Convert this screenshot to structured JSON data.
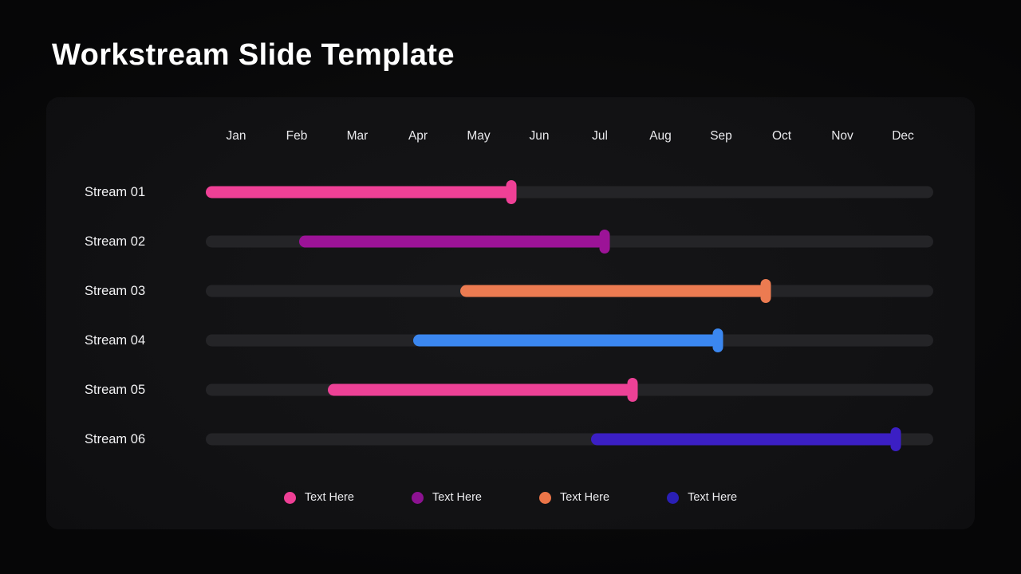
{
  "slide": {
    "title": "Workstream Slide Template",
    "background_color": "#060607",
    "card_color": "#121214",
    "track_color": "#242427"
  },
  "axis": {
    "months": [
      "Jan",
      "Feb",
      "Mar",
      "Apr",
      "May",
      "Jun",
      "Jul",
      "Aug",
      "Sep",
      "Oct",
      "Nov",
      "Dec"
    ]
  },
  "chart_data": {
    "type": "bar",
    "title": "Workstream Slide Template",
    "xlabel": "",
    "ylabel": "",
    "categories": [
      "Jan",
      "Feb",
      "Mar",
      "Apr",
      "May",
      "Jun",
      "Jul",
      "Aug",
      "Sep",
      "Oct",
      "Nov",
      "Dec"
    ],
    "grid": false,
    "legend_position": "bottom",
    "rows": [
      {
        "label": "Stream 01",
        "color": "#ef4096",
        "start_pct": 0.0,
        "end_pct": 42.0,
        "start_month": "Jan",
        "end_month": "Jun"
      },
      {
        "label": "Stream 02",
        "color": "#9c1397",
        "start_pct": 12.8,
        "end_pct": 54.8,
        "start_month": "Feb",
        "end_month": "Jul"
      },
      {
        "label": "Stream 03",
        "color": "#ec7b51",
        "start_pct": 35.0,
        "end_pct": 77.0,
        "start_month": "Apr",
        "end_month": "Sep"
      },
      {
        "label": "Stream 04",
        "color": "#3b87f0",
        "start_pct": 28.5,
        "end_pct": 70.4,
        "start_month": "Apr",
        "end_month": "Sep"
      },
      {
        "label": "Stream 05",
        "color": "#ed4196",
        "start_pct": 16.8,
        "end_pct": 58.7,
        "start_month": "Mar",
        "end_month": "Aug"
      },
      {
        "label": "Stream 06",
        "color": "#3b1fc4",
        "start_pct": 53.0,
        "end_pct": 94.8,
        "start_month": "Jul",
        "end_month": "Dec"
      }
    ],
    "legend": [
      {
        "label": "Text Here",
        "color": "#ee3f95"
      },
      {
        "label": "Text Here",
        "color": "#8c1291"
      },
      {
        "label": "Text Here",
        "color": "#eb7548"
      },
      {
        "label": "Text Here",
        "color": "#2a1fb6"
      }
    ]
  }
}
